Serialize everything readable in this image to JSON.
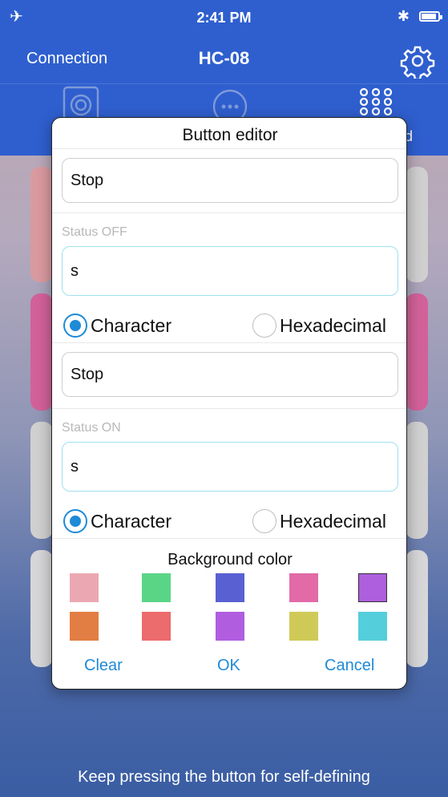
{
  "status_bar": {
    "time": "2:41 PM"
  },
  "nav": {
    "left_label": "Connection",
    "title": "HC-08"
  },
  "tabbar": {
    "partial_label": "d"
  },
  "footer": {
    "text": "Keep pressing the button for self-defining"
  },
  "dialog": {
    "title": "Button editor",
    "off_name_value": "Stop",
    "status_off_caption": "Status OFF",
    "off_command_value": "s",
    "off_mode": {
      "option1": "Character",
      "option2": "Hexadecimal",
      "selected": "Character"
    },
    "on_name_value": "Stop",
    "status_on_caption": "Status ON",
    "on_command_value": "s",
    "on_mode": {
      "option1": "Character",
      "option2": "Hexadecimal",
      "selected": "Character"
    },
    "background_color_title": "Background color",
    "swatches": [
      "#eca8b2",
      "#5ad586",
      "#5960d2",
      "#e16aa7",
      "#ad5fde",
      "#e27e43",
      "#ec6b6d",
      "#b05ddf",
      "#cfca58",
      "#55cedb"
    ],
    "selected_swatch": "#ad5fde",
    "buttons": {
      "clear": "Clear",
      "ok": "OK",
      "cancel": "Cancel"
    }
  },
  "colors": {
    "accent": "#1e8ad8",
    "nav_blue": "#2f5fcf"
  }
}
